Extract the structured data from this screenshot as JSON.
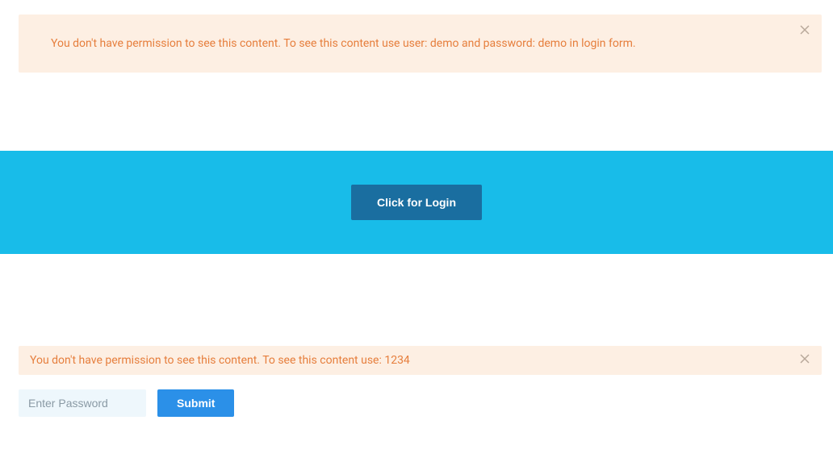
{
  "alerts": {
    "first": "You don't have permission to see this content. To see this content use user: demo and password: demo in login form.",
    "second": "You don't have permission to see this content. To see this content use: 1234"
  },
  "banner": {
    "login_button_label": "Click for Login"
  },
  "form": {
    "password_placeholder": "Enter Password",
    "submit_label": "Submit"
  }
}
